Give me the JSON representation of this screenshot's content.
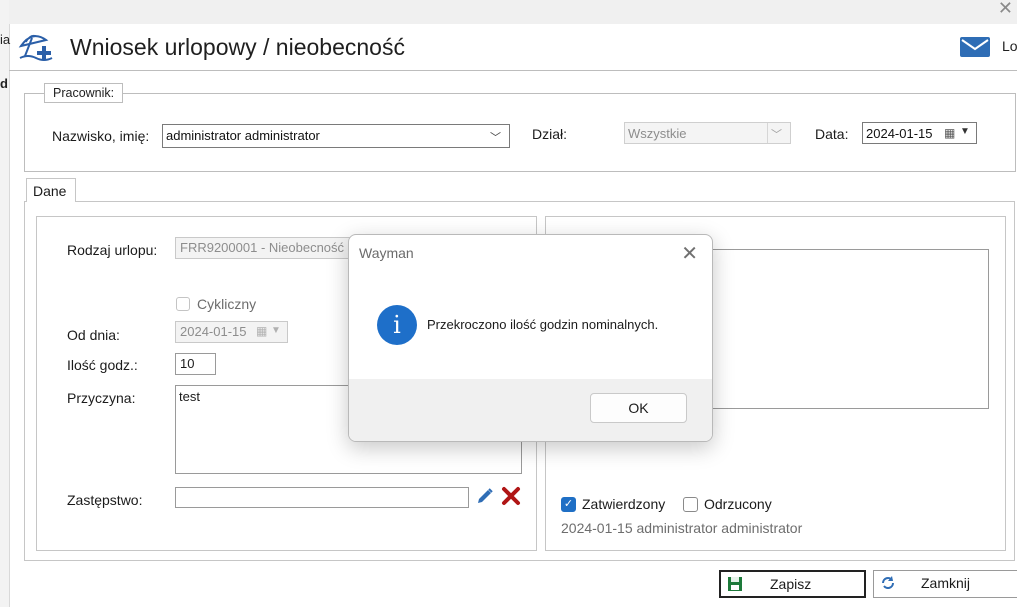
{
  "background_window": {
    "text1": "ia",
    "text2": "d"
  },
  "header": {
    "title": "Wniosek urlopowy / nieobecność",
    "mail_label": "Lo"
  },
  "employee": {
    "group_label": "Pracownik:",
    "name_label": "Nazwisko, imię:",
    "name_value": "administrator administrator",
    "dept_label": "Dział:",
    "dept_value": "Wszystkie",
    "date_label": "Data:",
    "date_value": "2024-01-15"
  },
  "tabs": [
    {
      "label": "Dane"
    }
  ],
  "form": {
    "leave_type_label": "Rodzaj urlopu:",
    "leave_type_value": "FRR9200001 - Nieobecność",
    "cyclic_label": "Cykliczny",
    "from_label": "Od dnia:",
    "from_value": "2024-01-15",
    "hours_label": "Ilość godz.:",
    "hours_value": "10",
    "reason_label": "Przyczyna:",
    "reason_value": "test",
    "substitute_label": "Zastępstwo:",
    "substitute_value": ""
  },
  "right_panel": {
    "approved_label": "Zatwierdzony",
    "approved_checked": true,
    "rejected_label": "Odrzucony",
    "rejected_checked": false,
    "approval_info": "2024-01-15 administrator administrator"
  },
  "dialog": {
    "title": "Wayman",
    "message": "Przekroczono ilość godzin nominalnych.",
    "ok_label": "OK"
  },
  "buttons": {
    "save_label": "Zapisz",
    "close_label": "Zamknij"
  },
  "colors": {
    "accent": "#1f6fc5",
    "info_icon": "#1e6fc9",
    "delete": "#b01515",
    "save_icon": "#1d7a3a"
  }
}
